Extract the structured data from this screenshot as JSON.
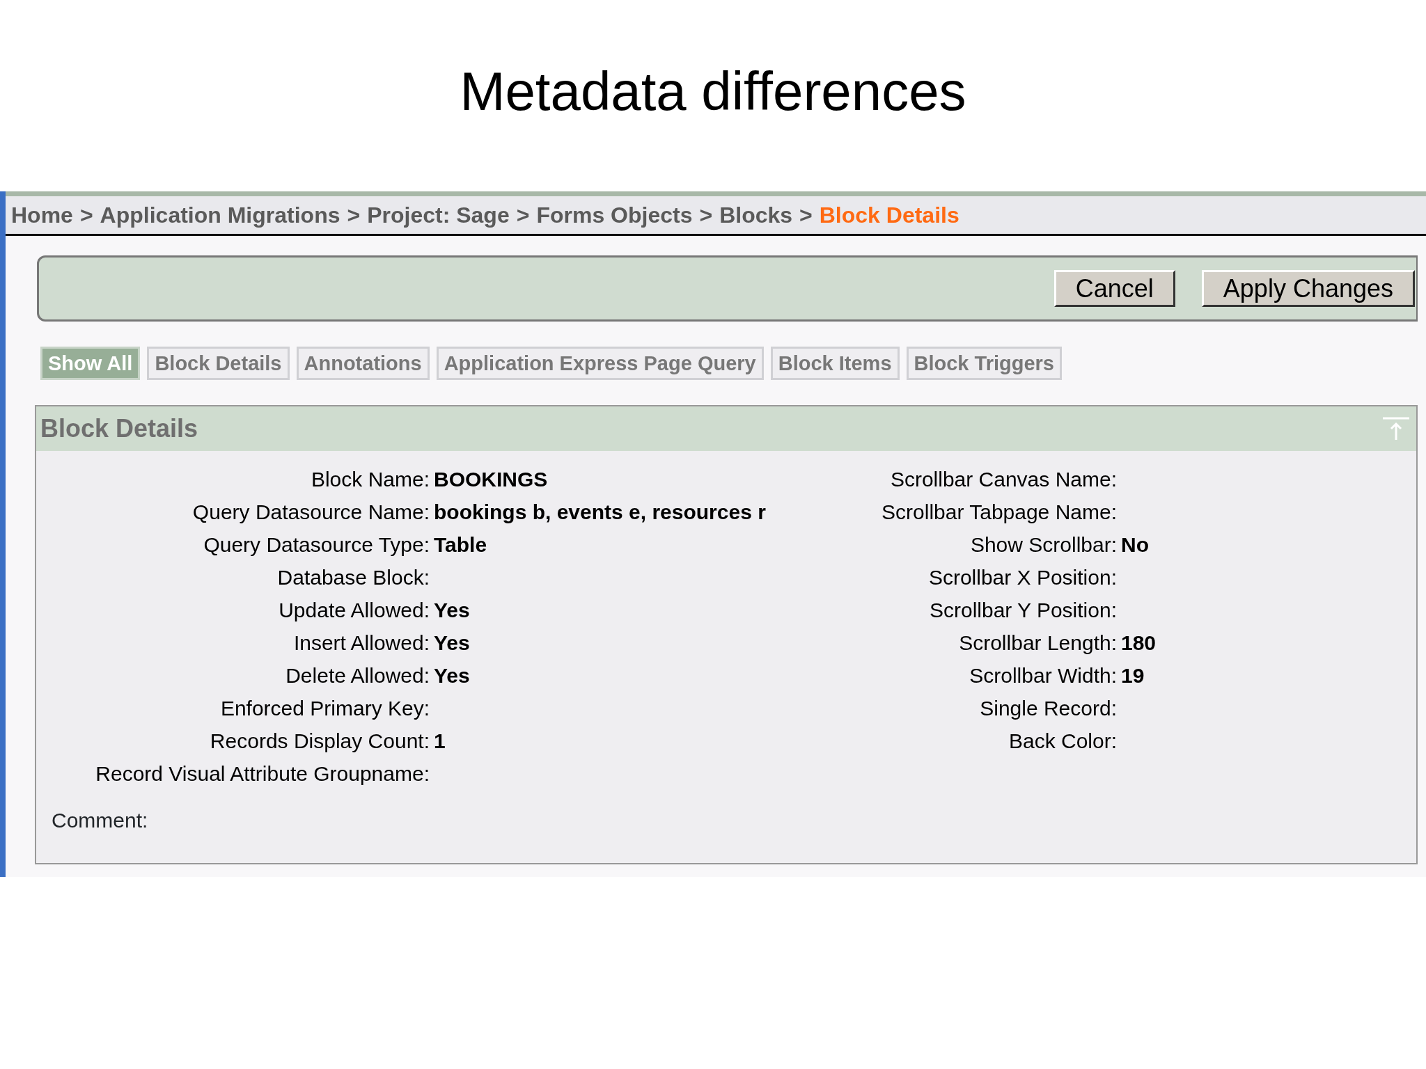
{
  "slide_title": "Metadata differences",
  "breadcrumb": [
    {
      "label": "Home",
      "selected": false
    },
    {
      "label": "Application Migrations",
      "selected": false
    },
    {
      "label": "Project: Sage",
      "selected": false
    },
    {
      "label": "Forms Objects",
      "selected": false
    },
    {
      "label": "Blocks",
      "selected": false
    },
    {
      "label": "Block Details",
      "selected": true
    }
  ],
  "breadcrumb_separator": ">",
  "buttons": [
    "Cancel",
    "Apply Changes"
  ],
  "tabs": [
    {
      "label": "Show All",
      "selected": true
    },
    {
      "label": "Block Details",
      "selected": false
    },
    {
      "label": "Annotations",
      "selected": false
    },
    {
      "label": "Application Express Page Query",
      "selected": false
    },
    {
      "label": "Block Items",
      "selected": false
    },
    {
      "label": "Block Triggers",
      "selected": false
    }
  ],
  "panel": {
    "title": "Block Details",
    "rows": [
      {
        "left": {
          "label": "Block Name:",
          "value": "BOOKINGS"
        },
        "right": {
          "label": "Scrollbar Canvas Name:"
        }
      },
      {
        "left": {
          "label": "Query Datasource Name:",
          "value": "bookings b, events e, resources r"
        },
        "right": {
          "label": "Scrollbar Tabpage Name:"
        }
      },
      {
        "left": {
          "label": "Query Datasource Type:",
          "value": "Table"
        },
        "right": {
          "label": "Show Scrollbar:",
          "value": "No"
        }
      },
      {
        "left": {
          "label": "Database Block:"
        },
        "right": {
          "label": "Scrollbar X Position:"
        }
      },
      {
        "left": {
          "label": "Update Allowed:",
          "value": "Yes"
        },
        "right": {
          "label": "Scrollbar Y Position:"
        }
      },
      {
        "left": {
          "label": "Insert Allowed:",
          "value": "Yes"
        },
        "right": {
          "label": "Scrollbar Length:",
          "value": "180"
        }
      },
      {
        "left": {
          "label": "Delete Allowed:",
          "value": "Yes"
        },
        "right": {
          "label": "Scrollbar Width:",
          "value": "19"
        }
      },
      {
        "left": {
          "label": "Enforced Primary Key:"
        },
        "right": {
          "label": "Single Record:"
        }
      },
      {
        "left": {
          "label": "Records Display Count:",
          "value": "1"
        },
        "right": {
          "label": "Back Color:"
        }
      },
      {
        "left": {
          "label": "Record Visual Attribute Groupname:"
        }
      }
    ],
    "comment_label": "Comment:"
  }
}
